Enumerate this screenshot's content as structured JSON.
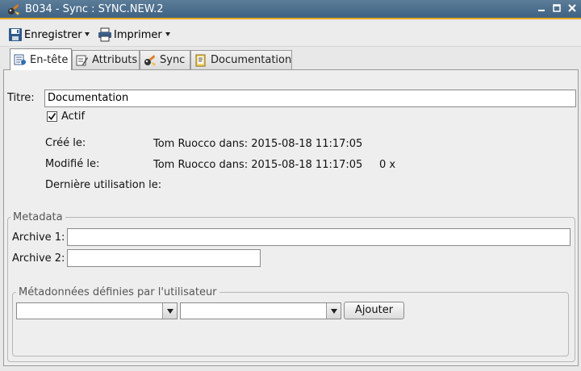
{
  "window": {
    "title": "B034 - Sync : SYNC.NEW.2"
  },
  "toolbar": {
    "save_label": "Enregistrer",
    "print_label": "Imprimer"
  },
  "tabs": [
    {
      "label": "En-tête",
      "icon": "header-icon",
      "active": true
    },
    {
      "label": "Attributs",
      "icon": "attributes-icon"
    },
    {
      "label": "Sync",
      "icon": "sync-icon"
    },
    {
      "label": "Documentation",
      "icon": "documentation-icon"
    }
  ],
  "header": {
    "title_label": "Titre:",
    "title_value": "Documentation",
    "active_label": "Actif",
    "active_checked": true,
    "created_label": "Créé le:",
    "created_value": "Tom Ruocco dans: 2015-08-18 11:17:05",
    "modified_label": "Modifié le:",
    "modified_value": "Tom Ruocco dans: 2015-08-18 11:17:05",
    "modified_count": "0 x",
    "last_used_label": "Dernière utilisation le:"
  },
  "metadata": {
    "group_label": "Metadata",
    "archive1_label": "Archive 1:",
    "archive1_value": "",
    "archive2_label": "Archive 2:",
    "archive2_value": "",
    "user_group_label": "Métadonnées définies par l'utilisateur",
    "combo1_value": "",
    "combo2_value": "",
    "add_label": "Ajouter"
  }
}
